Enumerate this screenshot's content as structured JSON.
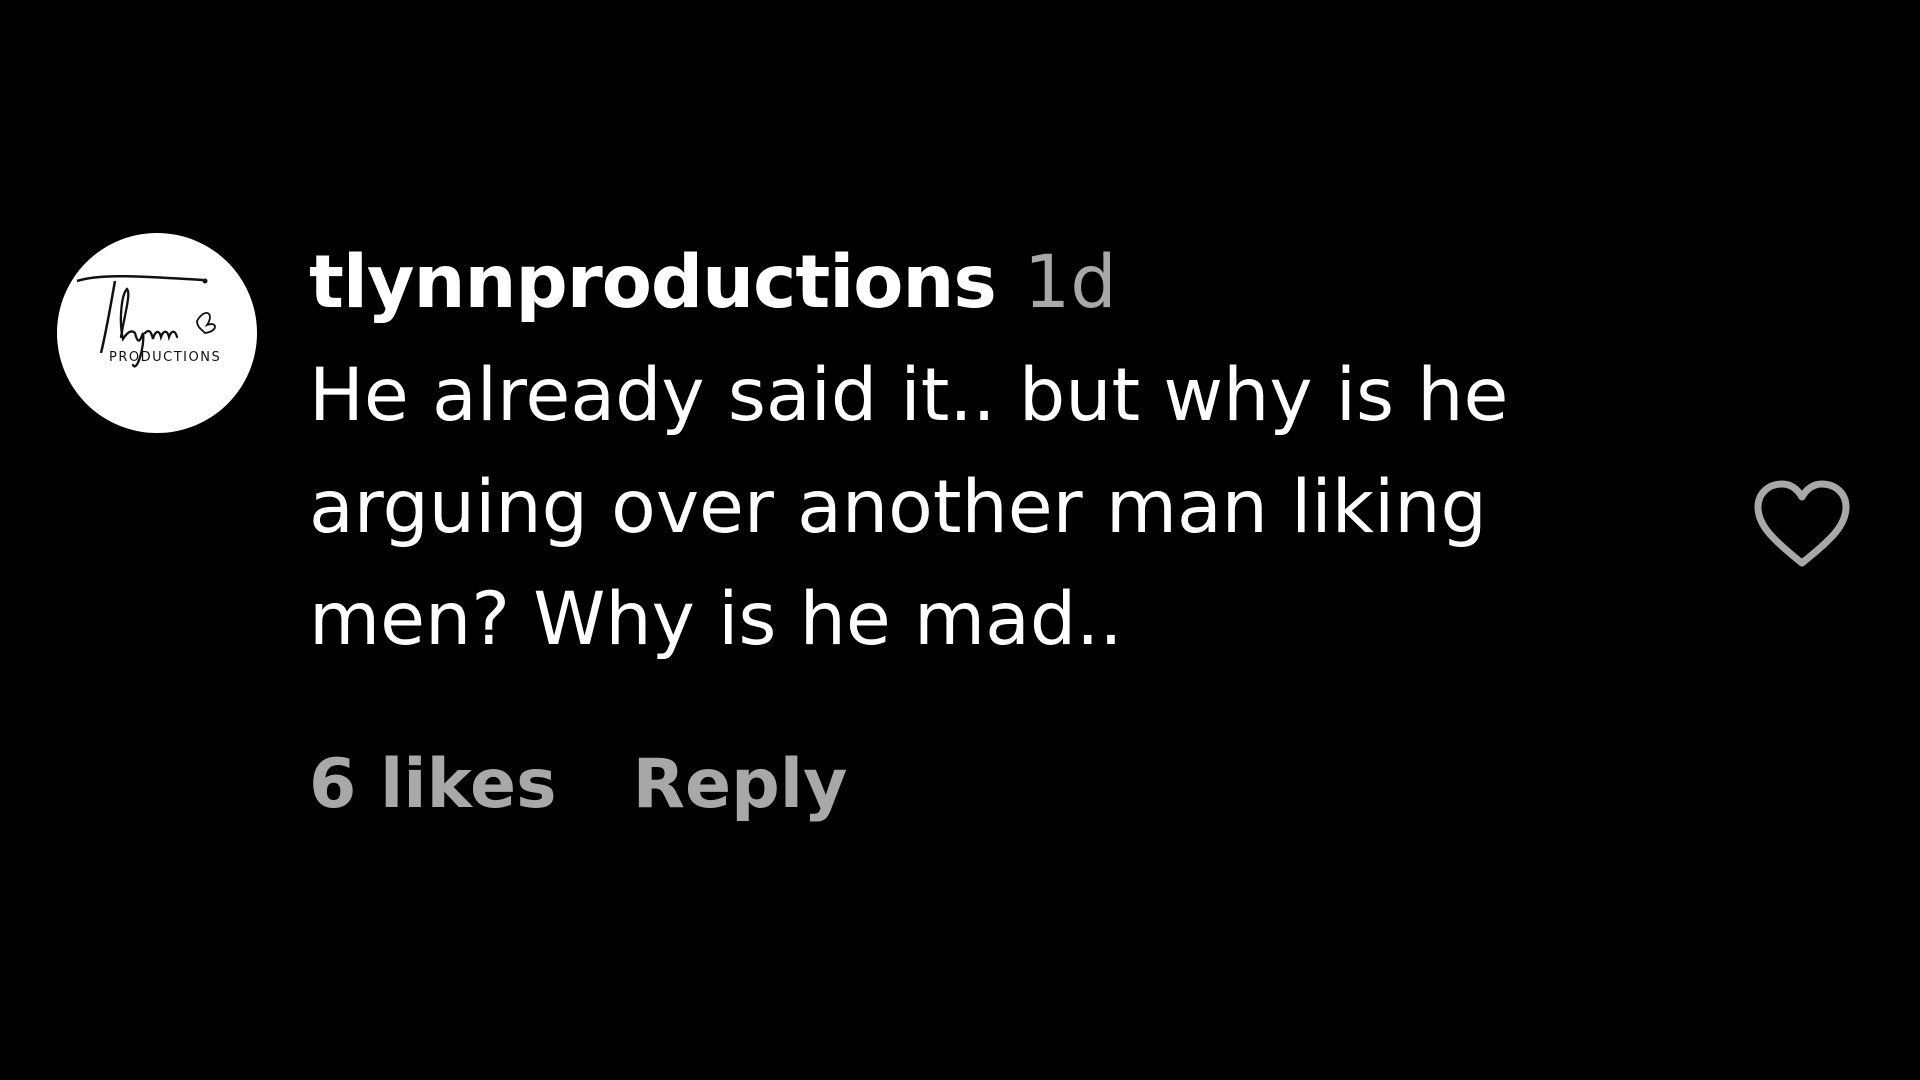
{
  "comment": {
    "avatar": {
      "logo_wordmark": "Tlynn",
      "logo_subtitle": "PRODUCTIONS"
    },
    "username": "tlynnproductions",
    "timestamp": "1d",
    "text_lines": [
      "He already said it.. but why is he",
      "arguing over another man liking",
      "men? Why is he mad.."
    ],
    "likes": "6 likes",
    "reply_label": "Reply",
    "like_icon": "heart-outline-icon"
  },
  "colors": {
    "background": "#000000",
    "primary_text": "#ffffff",
    "secondary_text": "#a8a8a8",
    "icon_stroke": "#a8a8a8"
  }
}
